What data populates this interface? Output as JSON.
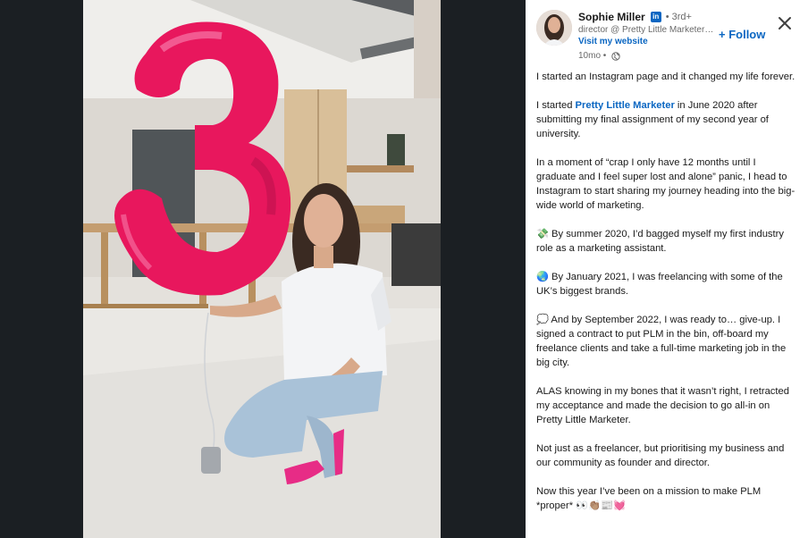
{
  "author": {
    "name": "Sophie Miller",
    "linkedin_badge": "in",
    "degree": "• 3rd+",
    "headline": "director @ Pretty Little Marketer | Helping You Grow",
    "website_label": "Visit my website",
    "post_age": "10mo •"
  },
  "actions": {
    "follow_label": "+ Follow",
    "close_icon": "close-icon"
  },
  "photo": {
    "balloon_number": "3",
    "balloon_color": "#e8175d"
  },
  "post": {
    "p1": "I started an Instagram page and it changed my life forever.",
    "p2_before": "I started ",
    "p2_link": "Pretty Little Marketer",
    "p2_after": " in June 2020 after submitting my final assignment of my second year of university.",
    "p3": "In a moment of “crap I only have 12 months until I graduate and I feel super lost and alone” panic, I head to Instagram to start sharing my journey heading into the big-wide world of marketing.",
    "p4": "💸 By summer 2020, I’d bagged myself my first industry role as a marketing assistant.",
    "p5": "🌏 By January 2021, I was freelancing with some of the UK’s biggest brands.",
    "p6": "💭 And by September 2022, I was ready to… give-up. I signed a contract to put PLM in the bin, off-board my freelance clients and take a full-time marketing job in the big city.",
    "p7": "ALAS knowing in my bones that it wasn’t right, I retracted my acceptance and made the decision to go all-in on Pretty Little Marketer.",
    "p8": "Not just as a freelancer, but prioritising my business and our community as founder and director.",
    "p9": "Now this year I’ve been on a mission to make PLM *proper* 👀👏🏽📰💓"
  },
  "colors": {
    "accent": "#0a66c2",
    "backdrop": "#1b1f23"
  }
}
